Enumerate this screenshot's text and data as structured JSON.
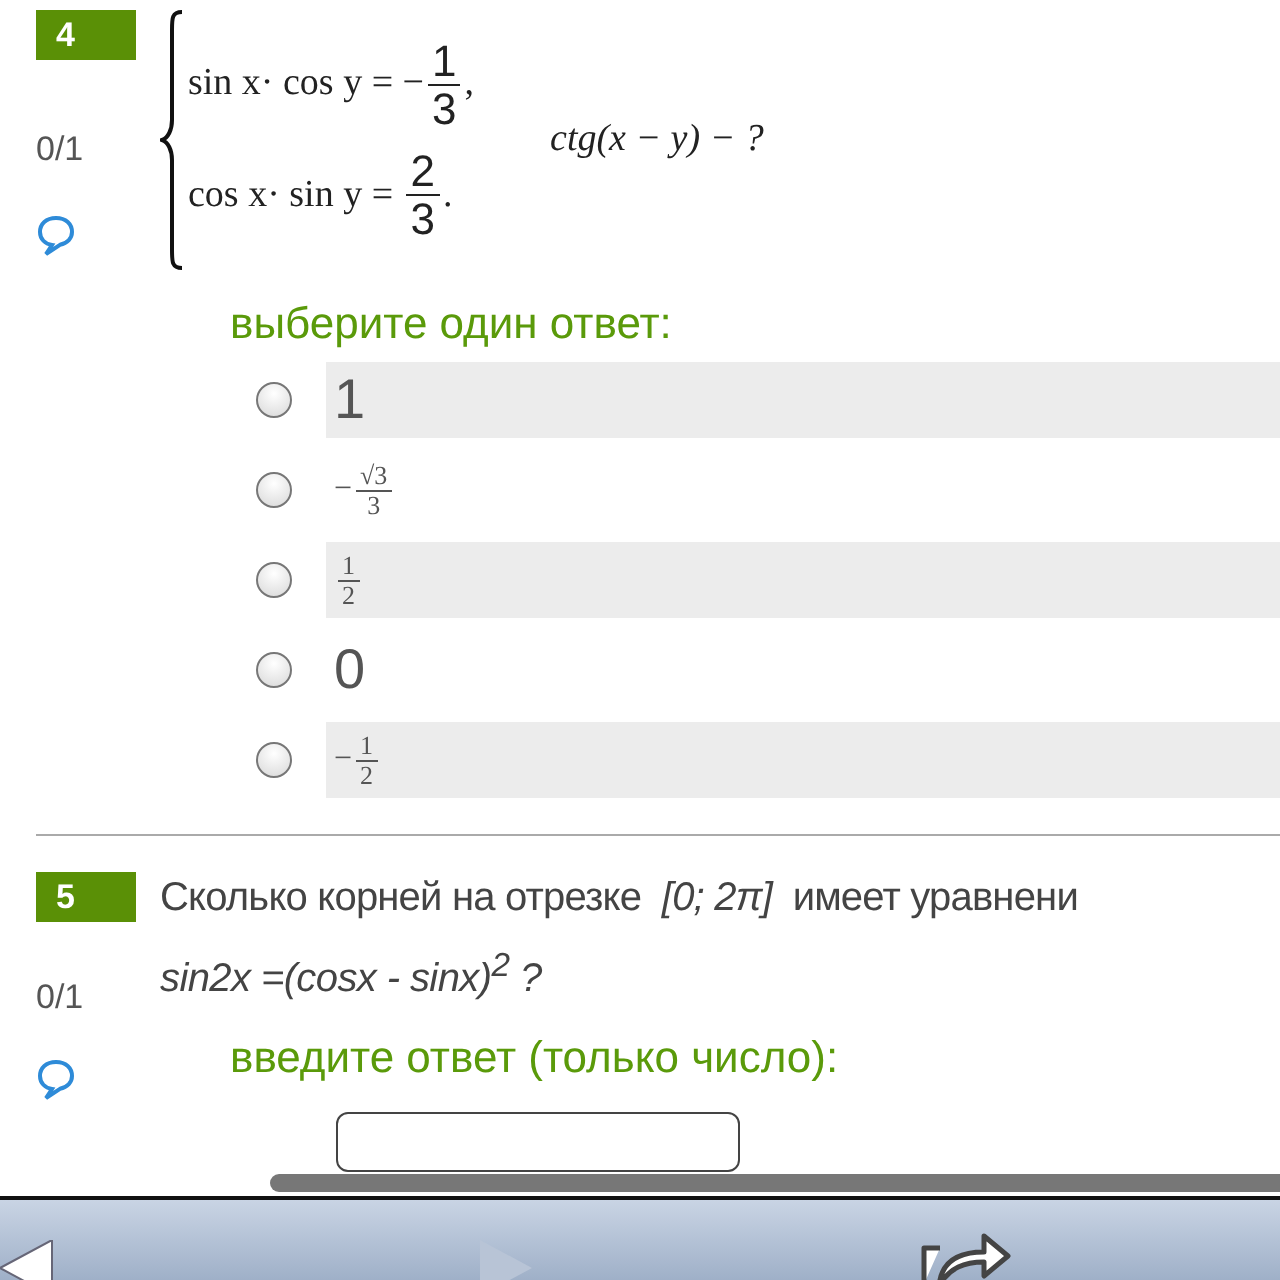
{
  "questions": [
    {
      "number": "4",
      "grade": "0/1",
      "kind": "system",
      "system": [
        {
          "lhs": "sin x· cos y = −",
          "num": "1",
          "den": "3",
          "tail": ","
        },
        {
          "lhs": "cos x· sin y = ",
          "num": "2",
          "den": "3",
          "tail": "."
        }
      ],
      "ask": "ctg(x − y) − ?",
      "prompt": "выберите один ответ:",
      "answer": {
        "kind": "choice",
        "options": [
          {
            "kind": "text",
            "label": "1",
            "selected": false
          },
          {
            "kind": "fraction",
            "sign": "−",
            "num": "√3",
            "den": "3",
            "selected": false
          },
          {
            "kind": "fraction",
            "num": "1",
            "den": "2",
            "selected": false
          },
          {
            "kind": "text",
            "label": "0",
            "selected": false
          },
          {
            "kind": "fraction",
            "sign": "−",
            "num": "1",
            "den": "2",
            "selected": false
          }
        ]
      }
    },
    {
      "number": "5",
      "grade": "0/1",
      "kind": "text",
      "text": "Сколько корней на отрезке  *[0; 2π]*  имеет уравнени",
      "equation": "sin2x =(cosx - sinx)$^{2}$ ?",
      "prompt": "введите ответ (только число):",
      "answer": {
        "kind": "input"
      }
    }
  ]
}
